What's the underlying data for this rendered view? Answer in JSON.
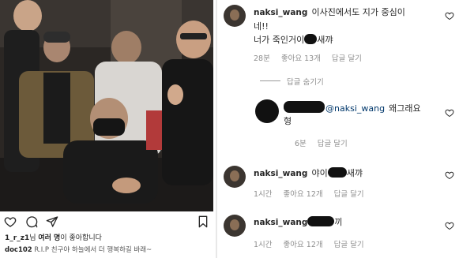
{
  "post": {
    "likes_user": "1_r_z1",
    "likes_suffix_1": "님 ",
    "likes_bold": "여러 명",
    "likes_suffix_2": "이 좋아합니다",
    "caption_user": "doc102",
    "caption_text": "R.I.P 친구야 하늘에서 더 행복하길 바래~",
    "icons": [
      "heart-icon",
      "comment-icon",
      "share-icon",
      "bookmark-icon"
    ]
  },
  "comments": {
    "c1": {
      "user": "naksi_wang",
      "text_line1": "이사진에서도 지가 중심이",
      "text_line2": "네!!",
      "text_line3a": "너가 죽인거이",
      "text_line3b": "새꺄",
      "time": "28분",
      "likes": "좋아요 13개",
      "reply": "답글 달기",
      "hide_replies": "답글 숨기기"
    },
    "c2": {
      "mention": "@naksi_wang",
      "text": "왜그래요",
      "text_line2": "형",
      "time": "6분",
      "reply": "답글 달기"
    },
    "c3": {
      "user": "naksi_wang",
      "text_a": "야이",
      "text_b": "새꺄",
      "time": "1시간",
      "likes": "좋아요 12개",
      "reply": "답글 달기"
    },
    "c4": {
      "user": "naksi_wang",
      "text_b": "끼",
      "time": "1시간",
      "likes": "좋아요 12개",
      "reply": "답글 달기"
    }
  }
}
